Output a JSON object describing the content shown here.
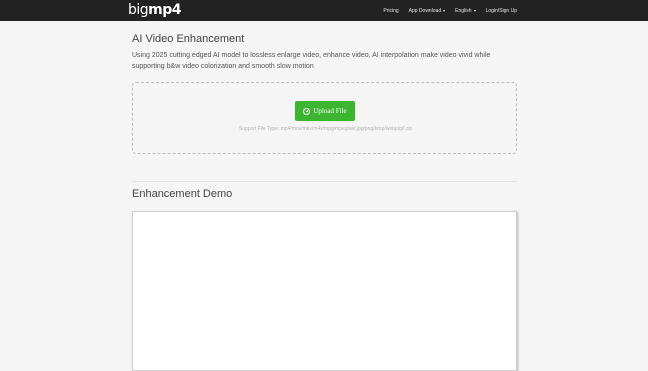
{
  "brand": {
    "logo_light": "big",
    "logo_bold": "mp4"
  },
  "nav": {
    "pricing": "Pricing",
    "app_download": "App Download",
    "language": "English",
    "login": "Login/Sign Up"
  },
  "hero": {
    "title": "AI Video Enhancement",
    "description": "Using 2025 cutting edged AI model to lossless enlarge video, enhance video, AI interpolation make video vivid while supporting b&w video colorization and smooth slow motion"
  },
  "upload": {
    "button_label": "Upload File",
    "support_text": "Support File Type: mp4/mov/mkv/m4v/mpg/mpeg/avi,jpg/png/bmp/webp/gif,zip"
  },
  "demo": {
    "title": "Enhancement Demo"
  },
  "colors": {
    "navbar": "#222222",
    "upload_button": "#3cb531",
    "page_bg": "#f5f5f5"
  }
}
